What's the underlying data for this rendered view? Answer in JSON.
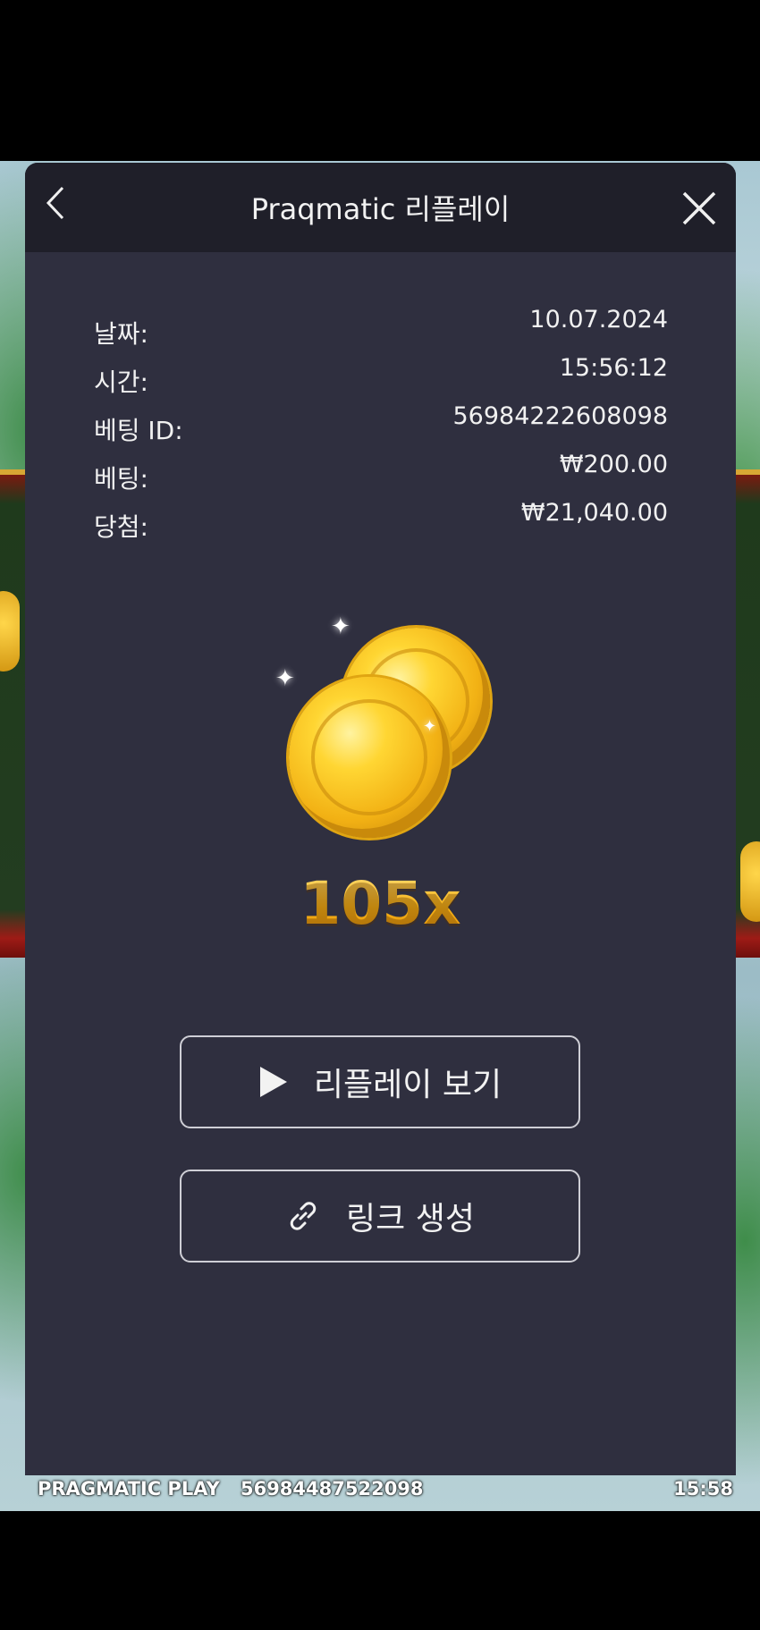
{
  "header": {
    "title": "Praqmatic 리플레이"
  },
  "info": [
    {
      "label": "날짜:",
      "value": "10.07.2024"
    },
    {
      "label": "시간:",
      "value": "15:56:12"
    },
    {
      "label": "베팅 ID:",
      "value": "56984222608098"
    },
    {
      "label": "베팅:",
      "value": "₩200.00"
    },
    {
      "label": "당첨:",
      "value": "₩21,040.00"
    }
  ],
  "win": {
    "multiplier": "105x"
  },
  "buttons": {
    "replay_label": "리플레이 보기",
    "link_label": "링크 생성"
  },
  "footer": {
    "brand": "PRAGMATIC PLAY",
    "round_id": "56984487522098",
    "clock": "15:58"
  },
  "colors": {
    "modal_bg": "#2f2f3f",
    "header_bg": "#1f1f29",
    "gold": "#f5b820"
  }
}
